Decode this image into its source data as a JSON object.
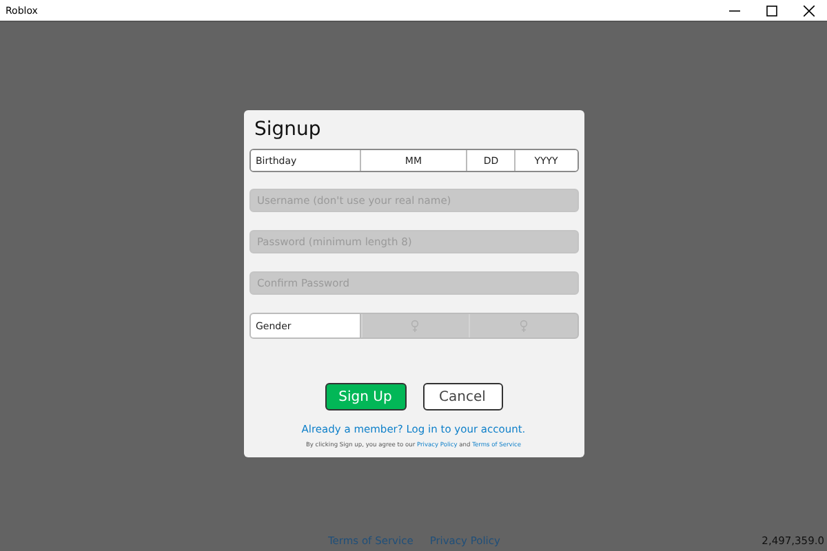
{
  "window": {
    "title": "Roblox"
  },
  "dialog": {
    "title": "Signup",
    "birthday": {
      "label": "Birthday",
      "month": "MM",
      "day": "DD",
      "year": "YYYY"
    },
    "fields": [
      {
        "placeholder": "Username (don't use your real name)",
        "disabled": true
      },
      {
        "placeholder": "Password (minimum length 8)",
        "disabled": true
      },
      {
        "placeholder": "Confirm Password",
        "disabled": true
      }
    ],
    "gender": {
      "label": "Gender",
      "disabled": true
    },
    "buttons": [
      {
        "label": "Sign Up",
        "kind": "primary"
      },
      {
        "label": "Cancel",
        "kind": "secondary"
      }
    ],
    "login_link": "Already a member? Log in to your account.",
    "legal": {
      "prefix": "By clicking Sign up, you agree to our",
      "privacy": "Privacy Policy",
      "joiner": "and",
      "terms": "Terms of Service"
    }
  },
  "footer": {
    "links": [
      "Terms of Service",
      "Privacy Policy"
    ],
    "version": "2,497,359.0"
  }
}
